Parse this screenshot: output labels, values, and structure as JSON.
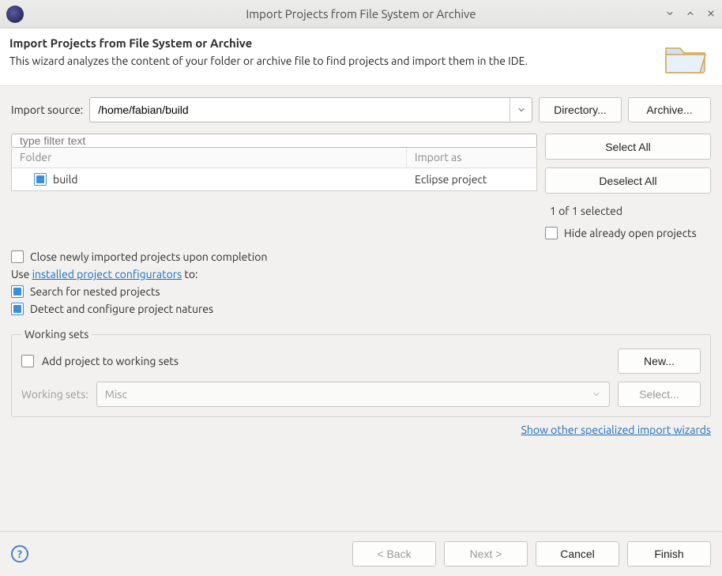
{
  "window": {
    "title": "Import Projects from File System or Archive"
  },
  "banner": {
    "heading": "Import Projects from File System or Archive",
    "description": "This wizard analyzes the content of your folder or archive file to find projects and import them in the IDE."
  },
  "source": {
    "label": "Import source:",
    "value": "/home/fabian/build",
    "directory_btn": "Directory...",
    "archive_btn": "Archive..."
  },
  "filter": {
    "placeholder": "type filter text"
  },
  "tree": {
    "col_folder": "Folder",
    "col_import_as": "Import as",
    "rows": [
      {
        "name": "build",
        "import_as": "Eclipse project",
        "checked": true
      }
    ]
  },
  "side": {
    "select_all": "Select All",
    "deselect_all": "Deselect All",
    "status": "1 of 1 selected",
    "hide_open": "Hide already open projects"
  },
  "options": {
    "close_new": "Close newly imported projects upon completion",
    "use_text": "Use ",
    "configurators_link": "installed project configurators",
    "to_text": " to:",
    "search_nested": "Search for nested projects",
    "detect_natures": "Detect and configure project natures"
  },
  "working_sets": {
    "legend": "Working sets",
    "add_label": "Add project to working sets",
    "new_btn": "New...",
    "sets_label": "Working sets:",
    "sets_value": "Misc",
    "select_btn": "Select..."
  },
  "under_link": "Show other specialized import wizards",
  "footer": {
    "back": "< Back",
    "next": "Next >",
    "cancel": "Cancel",
    "finish": "Finish"
  }
}
